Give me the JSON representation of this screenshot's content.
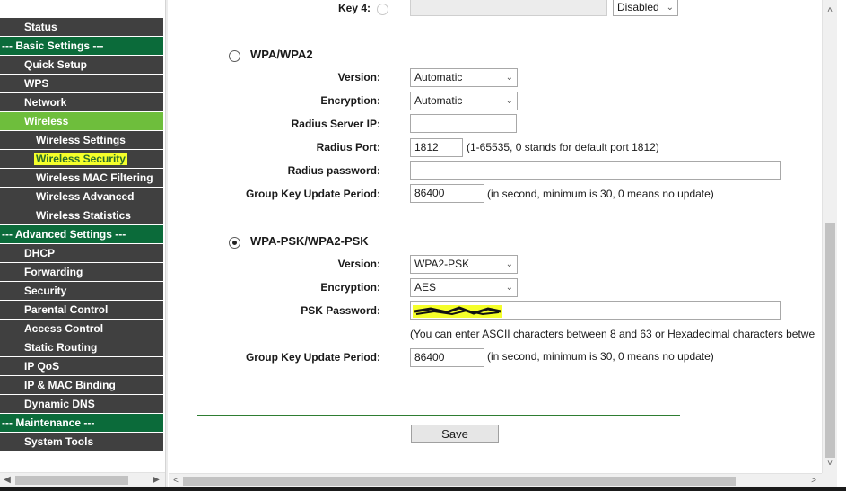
{
  "sidebar": {
    "items": [
      {
        "label": "Status",
        "kind": "item"
      },
      {
        "label": "--- Basic Settings ---",
        "kind": "section"
      },
      {
        "label": "Quick Setup",
        "kind": "item"
      },
      {
        "label": "WPS",
        "kind": "item"
      },
      {
        "label": "Network",
        "kind": "item"
      },
      {
        "label": "Wireless",
        "kind": "item",
        "active": true
      },
      {
        "label": "Wireless Settings",
        "kind": "sub"
      },
      {
        "label": "Wireless Security",
        "kind": "sub",
        "highlighted": true
      },
      {
        "label": "Wireless MAC Filtering",
        "kind": "sub"
      },
      {
        "label": "Wireless Advanced",
        "kind": "sub"
      },
      {
        "label": "Wireless Statistics",
        "kind": "sub"
      },
      {
        "label": "--- Advanced Settings ---",
        "kind": "section"
      },
      {
        "label": "DHCP",
        "kind": "item"
      },
      {
        "label": "Forwarding",
        "kind": "item"
      },
      {
        "label": "Security",
        "kind": "item"
      },
      {
        "label": "Parental Control",
        "kind": "item"
      },
      {
        "label": "Access Control",
        "kind": "item"
      },
      {
        "label": "Static Routing",
        "kind": "item"
      },
      {
        "label": "IP QoS",
        "kind": "item"
      },
      {
        "label": "IP & MAC Binding",
        "kind": "item"
      },
      {
        "label": "Dynamic DNS",
        "kind": "item"
      },
      {
        "label": "--- Maintenance ---",
        "kind": "section"
      },
      {
        "label": "System Tools",
        "kind": "item"
      }
    ]
  },
  "top": {
    "key4_label": "Key 4:",
    "key4_type": "Disabled"
  },
  "wpa": {
    "heading": "WPA/WPA2",
    "selected": false,
    "version_label": "Version:",
    "version_value": "Automatic",
    "encryption_label": "Encryption:",
    "encryption_value": "Automatic",
    "radius_ip_label": "Radius Server IP:",
    "radius_ip_value": "",
    "radius_port_label": "Radius Port:",
    "radius_port_value": "1812",
    "radius_port_hint": "(1-65535, 0 stands for default port 1812)",
    "radius_password_label": "Radius password:",
    "radius_password_value": "",
    "group_key_label": "Group Key Update Period:",
    "group_key_value": "86400",
    "group_key_hint": "(in second, minimum is 30, 0 means no update)"
  },
  "psk": {
    "heading": "WPA-PSK/WPA2-PSK",
    "selected": true,
    "version_label": "Version:",
    "version_value": "WPA2-PSK",
    "encryption_label": "Encryption:",
    "encryption_value": "AES",
    "psk_password_label": "PSK Password:",
    "psk_hint": "(You can enter ASCII characters between 8 and 63 or Hexadecimal characters betwe",
    "group_key_label": "Group Key Update Period:",
    "group_key_value": "86400",
    "group_key_hint": "(in second, minimum is 30, 0 means no update)"
  },
  "actions": {
    "save_label": "Save"
  },
  "colors": {
    "sidebar_item": "#404040",
    "sidebar_section": "#0b6b3a",
    "sidebar_active": "#6ebe3c",
    "highlight": "#f5ff2a"
  }
}
